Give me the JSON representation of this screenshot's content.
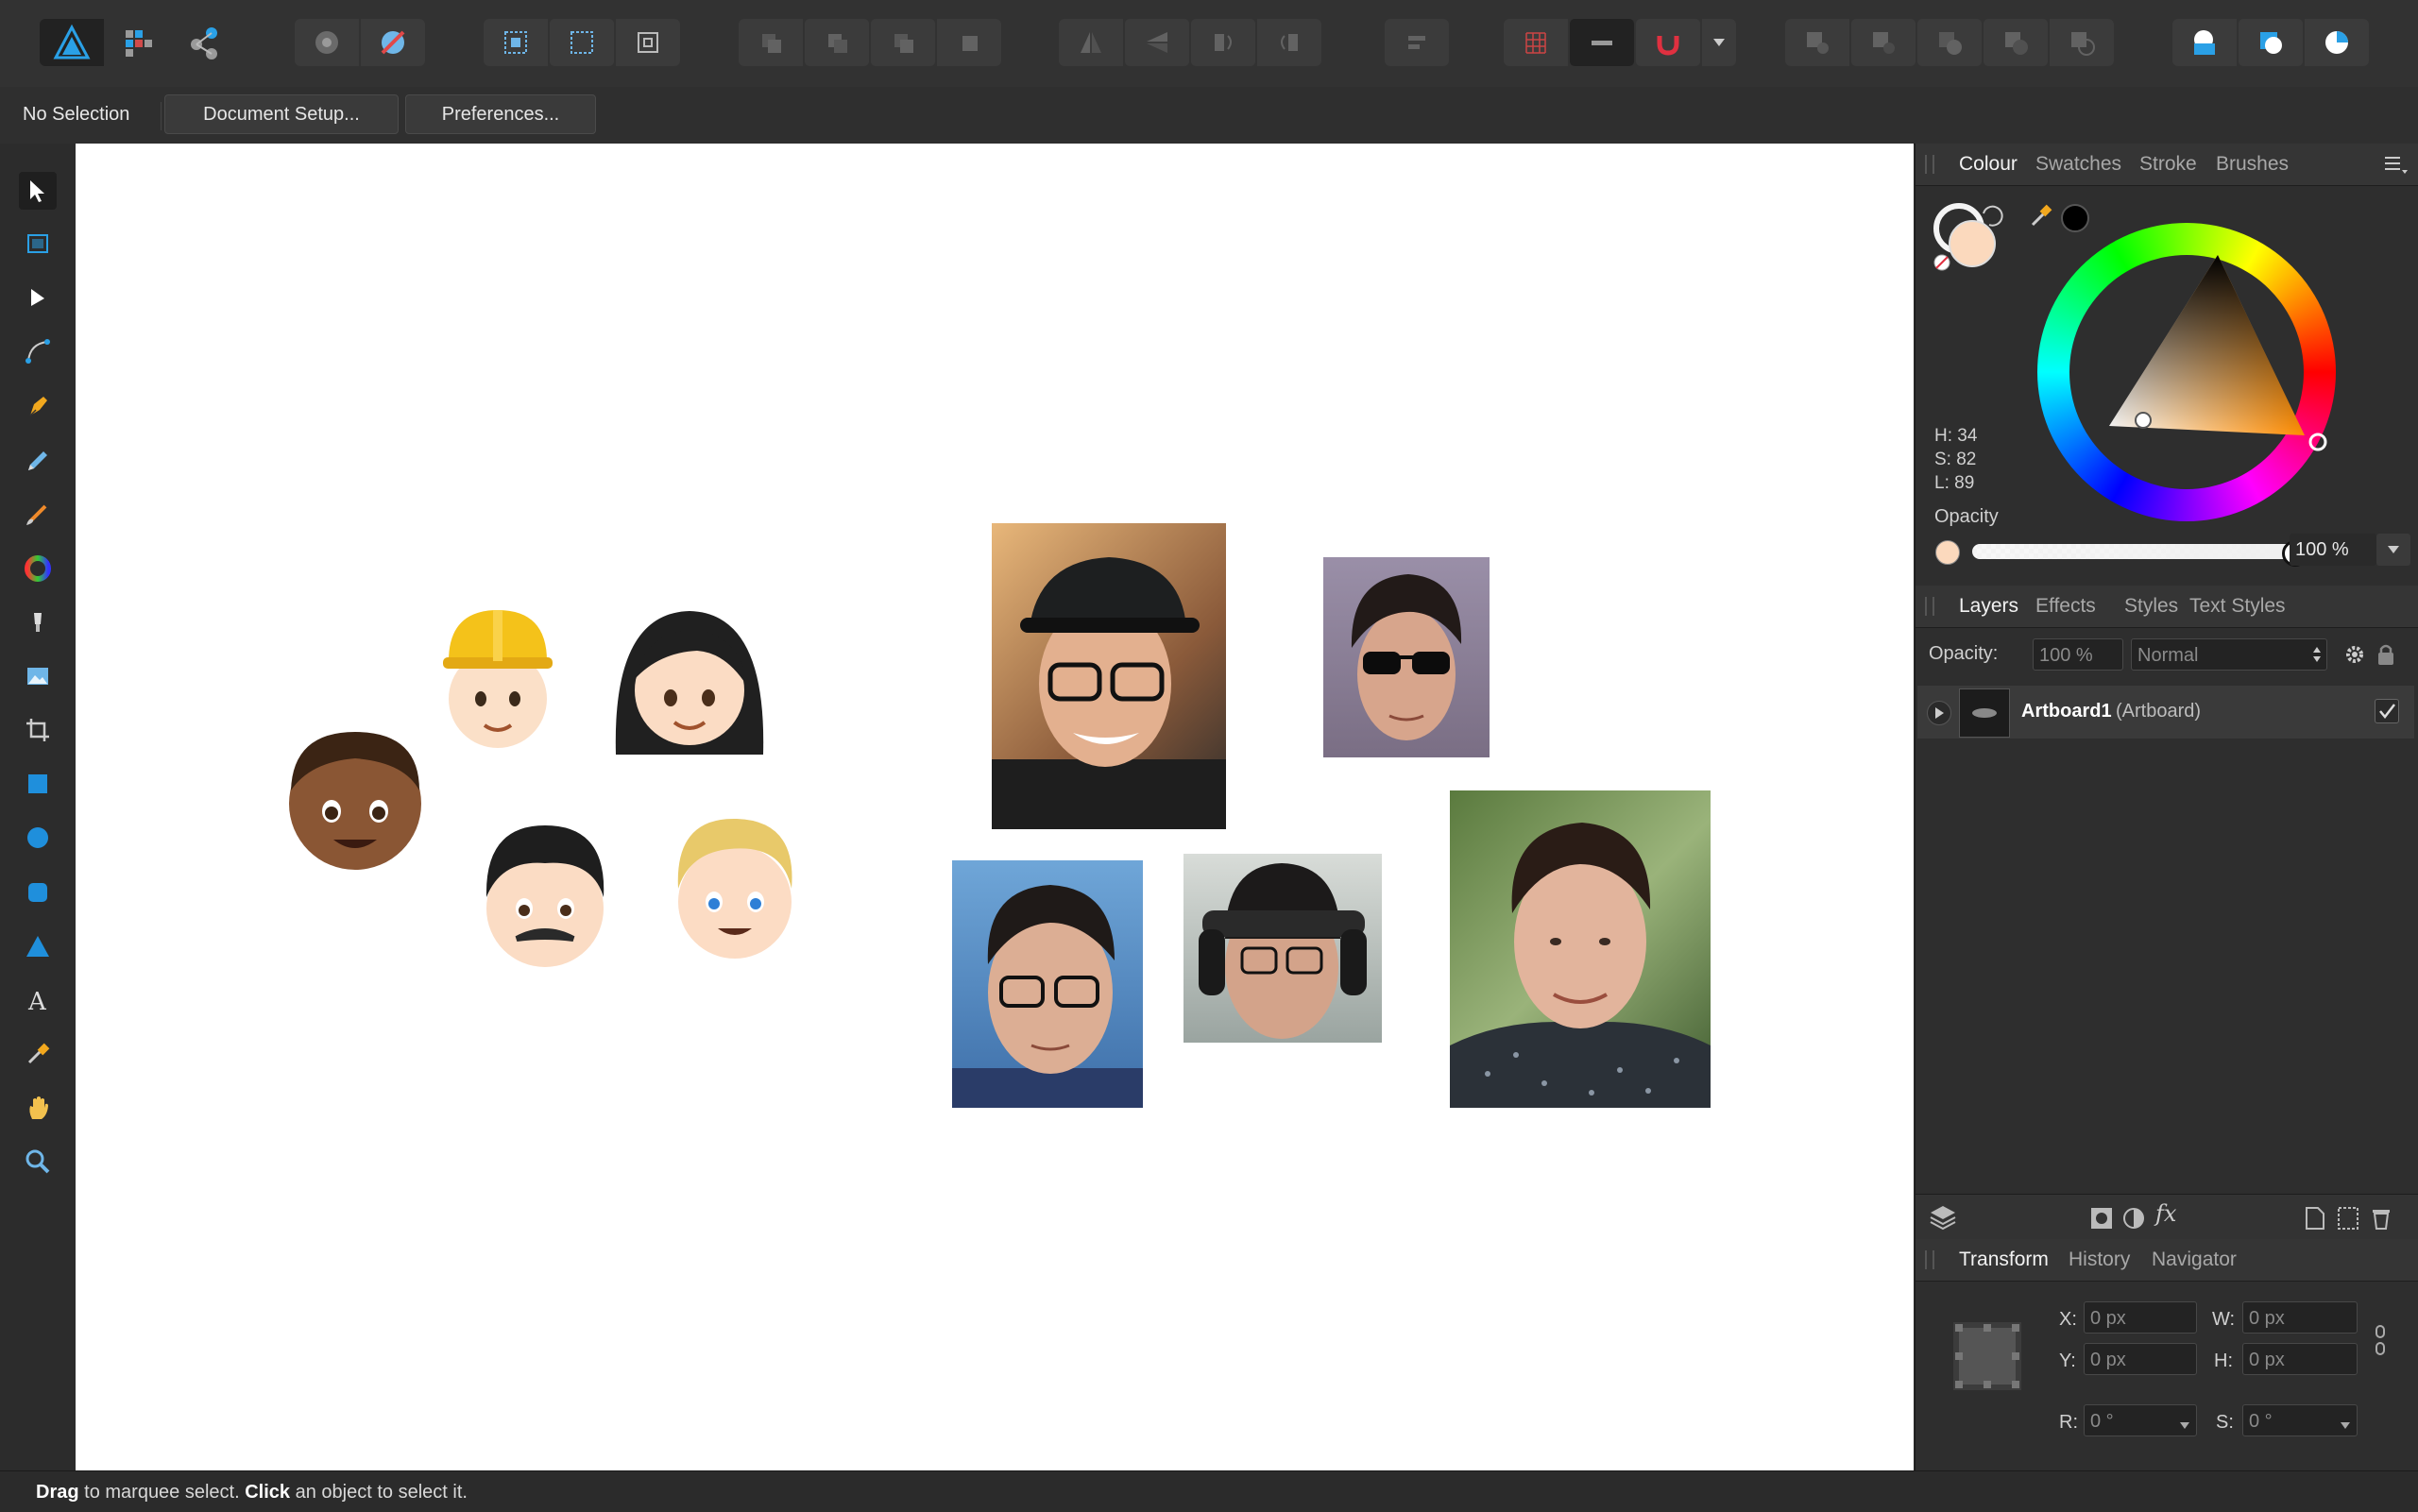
{
  "context_bar": {
    "selection": "No Selection",
    "document_setup": "Document Setup...",
    "preferences": "Preferences..."
  },
  "colour_panel": {
    "tabs": [
      "Colour",
      "Swatches",
      "Stroke",
      "Brushes"
    ],
    "active_tab": "Colour",
    "h": "H: 34",
    "s": "S: 82",
    "l": "L: 89",
    "opacity_label": "Opacity",
    "opacity_value": "100 %",
    "fill_color": "#fbd9bd"
  },
  "layers_panel": {
    "tabs": [
      "Layers",
      "Effects",
      "Styles",
      "Text Styles"
    ],
    "active_tab": "Layers",
    "opacity_label": "Opacity:",
    "opacity_value": "100 %",
    "blend_mode": "Normal",
    "layer_name": "Artboard1",
    "layer_type": "(Artboard)"
  },
  "transform_panel": {
    "tabs": [
      "Transform",
      "History",
      "Navigator"
    ],
    "active_tab": "Transform",
    "x_label": "X:",
    "x_value": "0 px",
    "y_label": "Y:",
    "y_value": "0 px",
    "w_label": "W:",
    "w_value": "0 px",
    "h_label": "H:",
    "h_value": "0 px",
    "r_label": "R:",
    "r_value": "0 °",
    "s_label": "S:",
    "s_value": "0 °"
  },
  "status": {
    "drag": "Drag",
    "drag_text": " to marquee select. ",
    "click": "Click",
    "click_text": " an object to select it."
  },
  "colors": {
    "accent": "#2aa0e6",
    "panel_bg": "#2e2e2e",
    "toolbar_bg": "#323232",
    "canvas": "#ffffff"
  }
}
